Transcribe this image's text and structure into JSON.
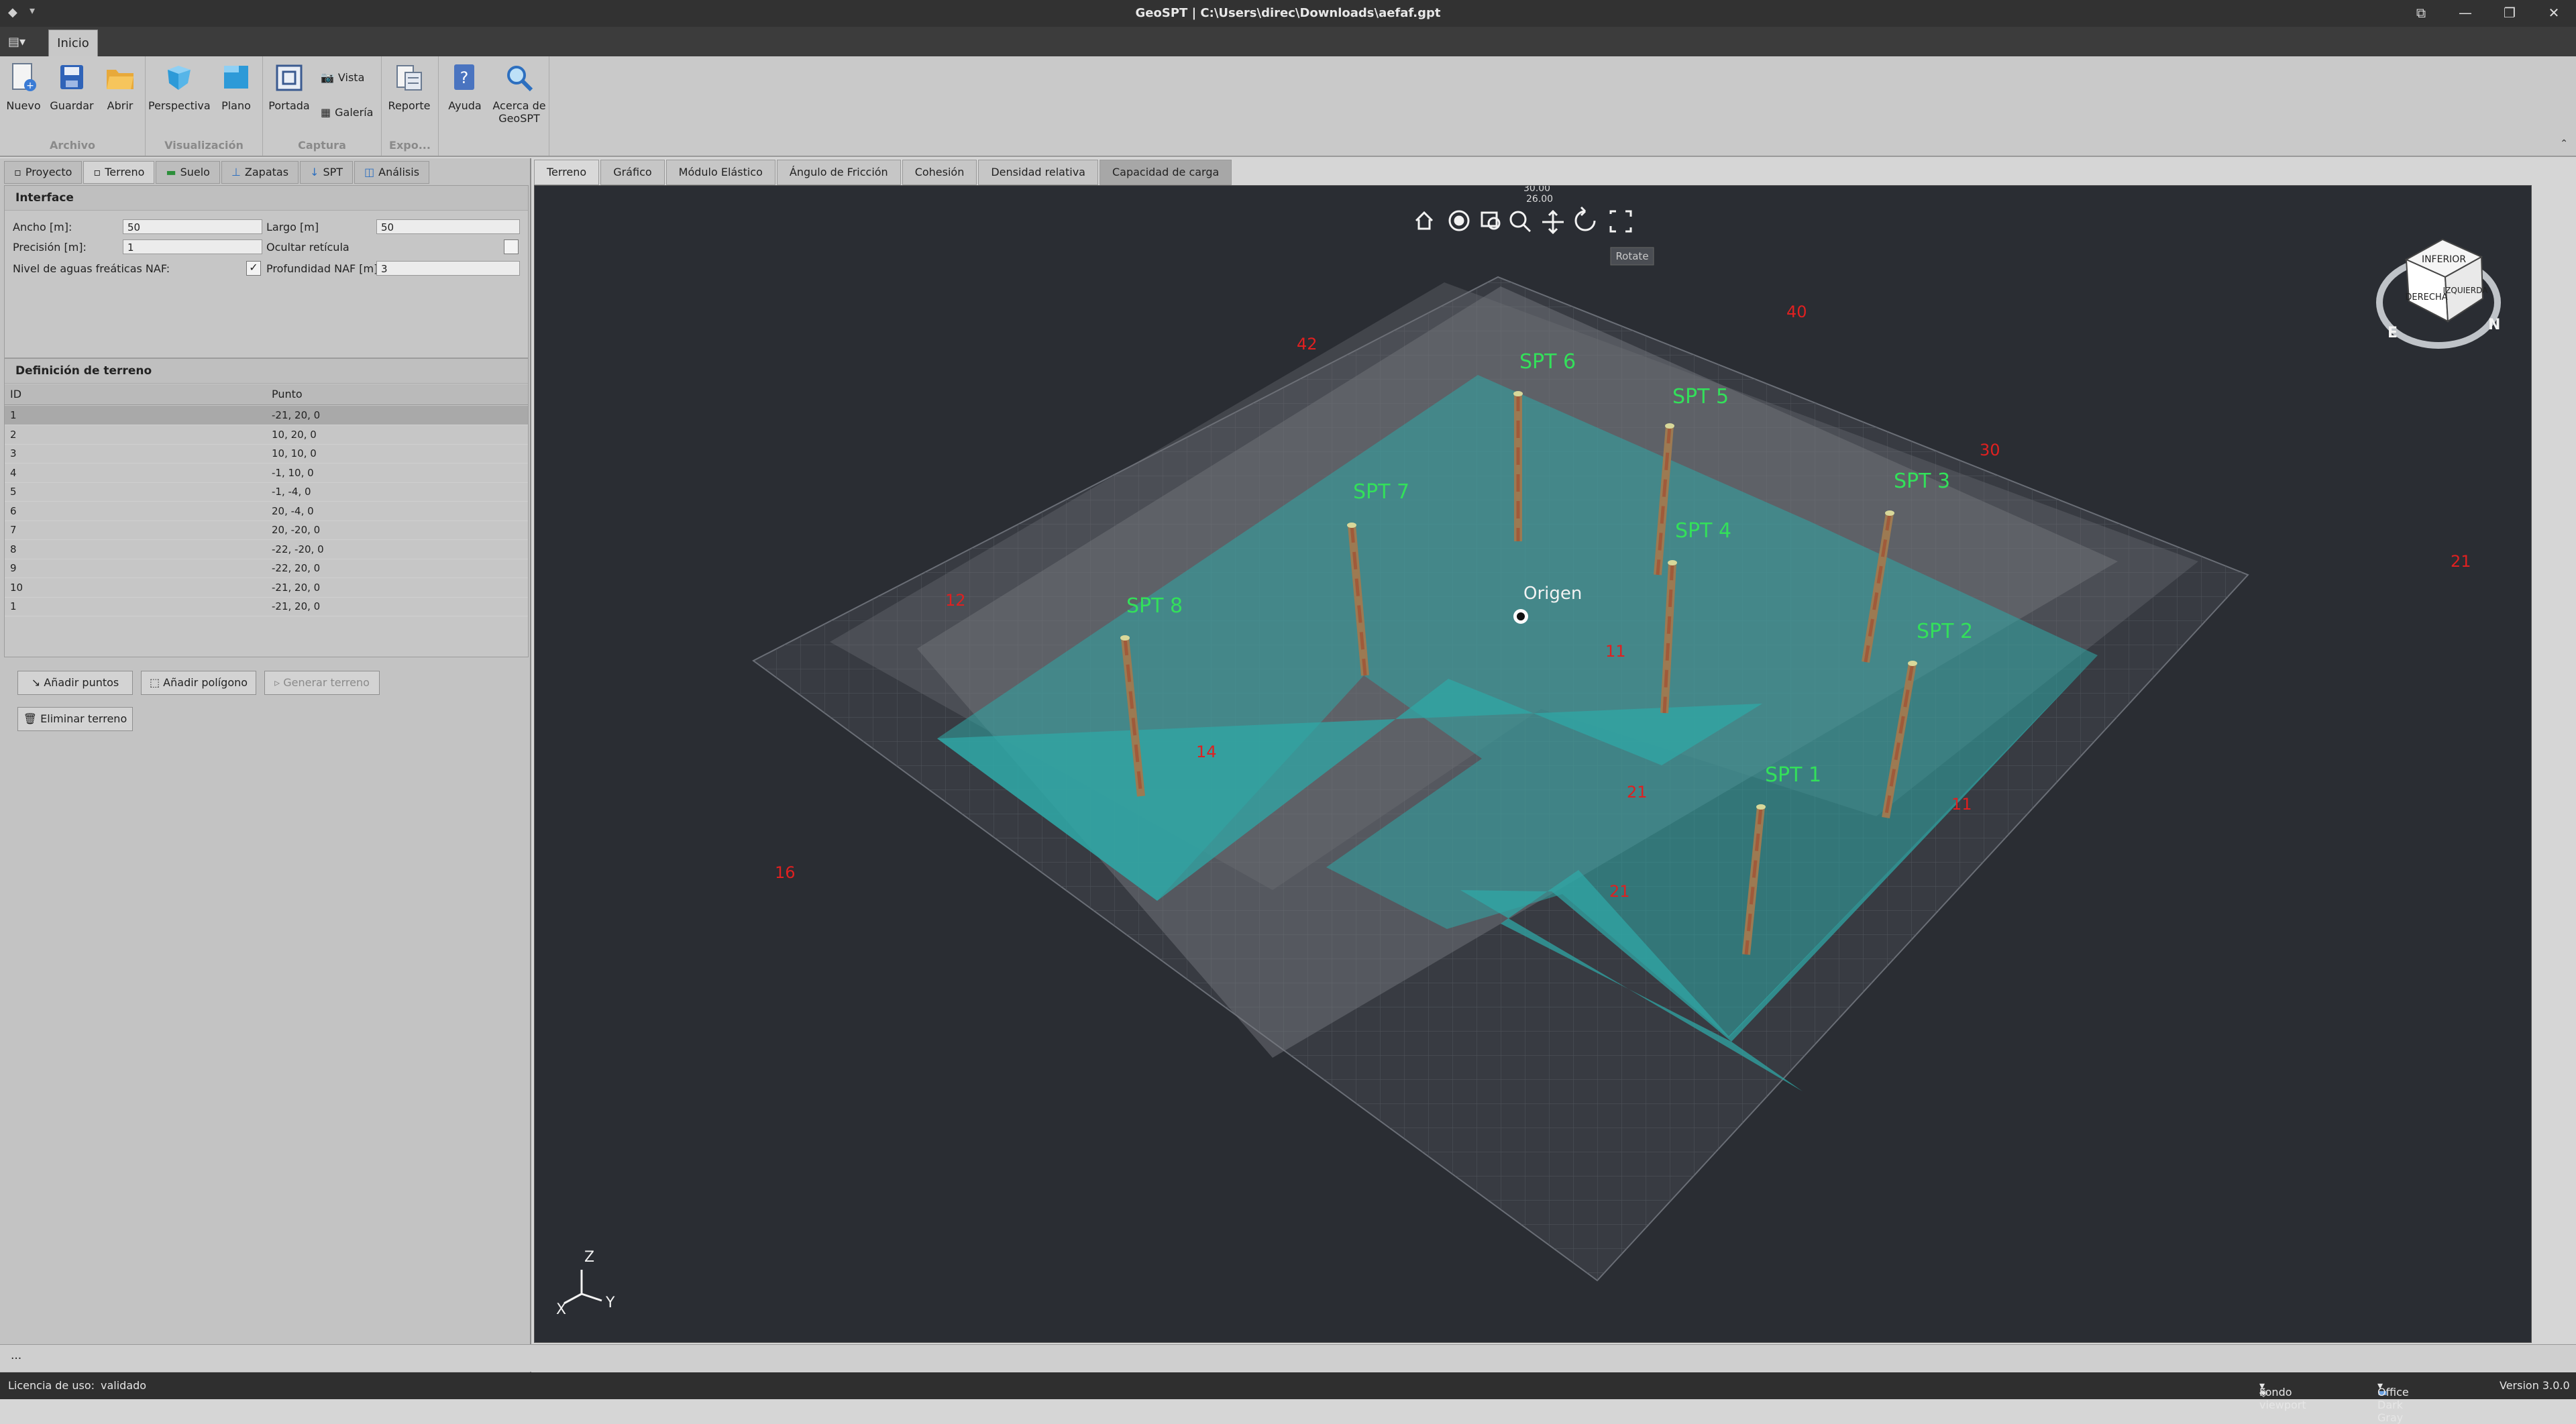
{
  "window": {
    "title": "GeoSPT | C:\\Users\\direc\\Downloads\\aefaf.gpt",
    "controls": [
      "⧉",
      "—",
      "❐",
      "✕"
    ]
  },
  "ribbon": {
    "tab": "Inicio",
    "groups": {
      "archivo": {
        "label": "Archivo",
        "nuevo": "Nuevo",
        "guardar": "Guardar",
        "abrir": "Abrir"
      },
      "visualizacion": {
        "label": "Visualización",
        "perspectiva": "Perspectiva",
        "plano": "Plano"
      },
      "captura": {
        "label": "Captura",
        "portada": "Portada",
        "vista": "Vista",
        "galeria": "Galería"
      },
      "expo": {
        "label": "Expo...",
        "reporte": "Reporte"
      },
      "ayuda": {
        "ayuda": "Ayuda",
        "acerca_l1": "Acerca de",
        "acerca_l2": "GeoSPT"
      }
    }
  },
  "left_tabs": [
    "Proyecto",
    "Terreno",
    "Suelo",
    "Zapatas",
    "SPT",
    "Análisis"
  ],
  "interface": {
    "title": "Interface",
    "ancho_label": "Ancho [m]:",
    "ancho_value": "50",
    "largo_label": "Largo [m]",
    "largo_value": "50",
    "precision_label": "Precisión [m]:",
    "precision_value": "1",
    "ocultar_label": "Ocultar retícula",
    "naf_label": "Nivel de aguas freáticas NAF:",
    "prof_label": "Profundidad NAF [m]",
    "prof_value": "3"
  },
  "terrain_def": {
    "title": "Definición de terreno",
    "col_id": "ID",
    "col_punto": "Punto",
    "rows": [
      {
        "id": "1",
        "punto": "-21, 20, 0"
      },
      {
        "id": "2",
        "punto": "10, 20, 0"
      },
      {
        "id": "3",
        "punto": "10, 10, 0"
      },
      {
        "id": "4",
        "punto": "-1, 10, 0"
      },
      {
        "id": "5",
        "punto": "-1, -4, 0"
      },
      {
        "id": "6",
        "punto": "20, -4, 0"
      },
      {
        "id": "7",
        "punto": "20, -20, 0"
      },
      {
        "id": "8",
        "punto": "-22, -20, 0"
      },
      {
        "id": "9",
        "punto": "-22, 20, 0"
      },
      {
        "id": "10",
        "punto": "-21, 20, 0"
      },
      {
        "id": "1",
        "punto": "-21, 20, 0"
      }
    ]
  },
  "buttons": {
    "add_points": "Añadir puntos",
    "add_polygon": "Añadir polígono",
    "generate": "Generar terreno",
    "delete": "Eliminar terreno"
  },
  "view_tabs": [
    "Terreno",
    "Gráfico",
    "Módulo Elástico",
    "Ángulo de Fricción",
    "Cohesión",
    "Densidad relativa",
    "Capacidad de carga"
  ],
  "viewport": {
    "tooltip": "Rotate",
    "origin_label": "Origen",
    "zoom_readout_top": "30.00",
    "zoom_readout_bottom": "26.00",
    "spt_labels": [
      "SPT 1",
      "SPT 2",
      "SPT 3",
      "SPT 4",
      "SPT 5",
      "SPT 6",
      "SPT 7",
      "SPT 8"
    ],
    "dims": [
      "42",
      "40",
      "30",
      "12",
      "11",
      "14",
      "16",
      "21",
      "11",
      "21",
      "21"
    ],
    "axes": {
      "z": "Z",
      "y": "Y",
      "x": "X"
    },
    "cube": {
      "top": "INFERIOR",
      "left": "DERECHA",
      "right": "IZQUIERDA",
      "e": "E",
      "n": "N"
    },
    "colors": {
      "background": "#2a2d33",
      "terrain": "#2fa7a5",
      "spt_label": "#33e05a",
      "dimension": "#e02020"
    }
  },
  "status": {
    "license_label": "Licencia de uso:",
    "license_value": "validado",
    "fondo": "Fondo viewport",
    "theme": "Office Dark Gray",
    "version": "Version 3.0.0",
    "bottom_dots": "..."
  }
}
